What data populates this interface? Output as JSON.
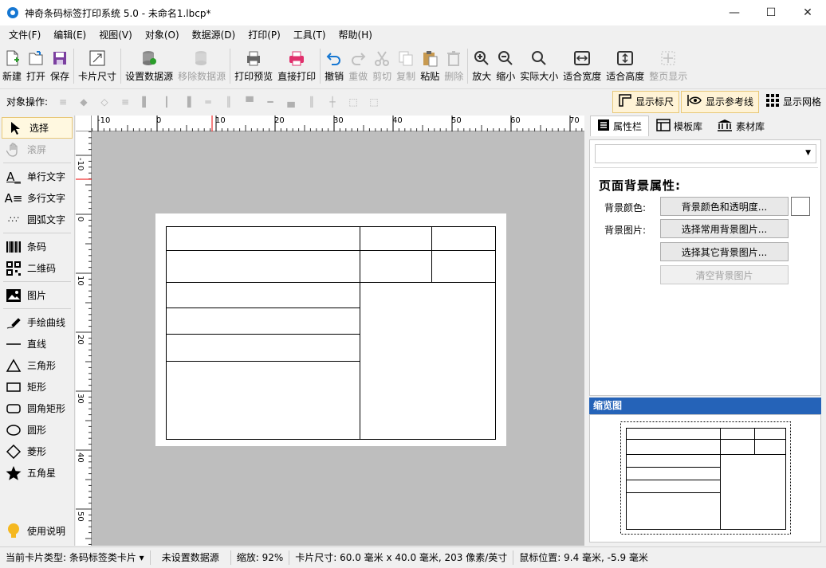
{
  "window": {
    "title": "神奇条码标签打印系统 5.0 - 未命名1.lbcp*"
  },
  "menu": [
    "文件(F)",
    "编辑(E)",
    "视图(V)",
    "对象(O)",
    "数据源(D)",
    "打印(P)",
    "工具(T)",
    "帮助(H)"
  ],
  "toolbar": {
    "new": "新建",
    "open": "打开",
    "save": "保存",
    "card_size": "卡片尺寸",
    "set_datasource": "设置数据源",
    "remove_datasource": "移除数据源",
    "print_preview": "打印预览",
    "direct_print": "直接打印",
    "undo": "撤销",
    "redo": "重做",
    "cut": "剪切",
    "copy": "复制",
    "paste": "粘贴",
    "delete": "删除",
    "zoom_in": "放大",
    "zoom_out": "缩小",
    "actual_size": "实际大小",
    "fit_width": "适合宽度",
    "fit_height": "适合高度",
    "fit_page": "整页显示"
  },
  "objbar": {
    "label": "对象操作:",
    "show_ruler": "显示标尺",
    "show_guides": "显示参考线",
    "show_grid": "显示网格"
  },
  "tools": {
    "select": "选择",
    "scroll": "滚屏",
    "single_text": "单行文字",
    "multi_text": "多行文字",
    "arc_text": "圆弧文字",
    "barcode": "条码",
    "qrcode": "二维码",
    "image": "图片",
    "freehand": "手绘曲线",
    "line": "直线",
    "triangle": "三角形",
    "rect": "矩形",
    "round_rect": "圆角矩形",
    "ellipse": "圆形",
    "diamond": "菱形",
    "star": "五角星",
    "help": "使用说明"
  },
  "ruler": {
    "h_labels": [
      "-10",
      "0",
      "10",
      "20",
      "30",
      "40",
      "50",
      "60",
      "70"
    ],
    "v_labels": [
      "-10",
      "0",
      "10",
      "20",
      "30",
      "40",
      "50"
    ]
  },
  "panel": {
    "tabs": [
      "属性栏",
      "模板库",
      "素材库"
    ],
    "section_title": "页面背景属性:",
    "bg_color_label": "背景颜色:",
    "bg_image_label": "背景图片:",
    "btn_color": "背景颜色和透明度...",
    "btn_common_image": "选择常用背景图片...",
    "btn_other_image": "选择其它背景图片...",
    "btn_clear_image": "清空背景图片",
    "preview_title": "缩览图"
  },
  "status": {
    "card_type": "当前卡片类型: 条码标签类卡片 ▾",
    "datasource": "未设置数据源",
    "zoom": "缩放: 92%",
    "card_size": "卡片尺寸: 60.0 毫米 x 40.0 毫米, 203 像素/英寸",
    "mouse": "鼠标位置: 9.4 毫米, -5.9 毫米"
  }
}
